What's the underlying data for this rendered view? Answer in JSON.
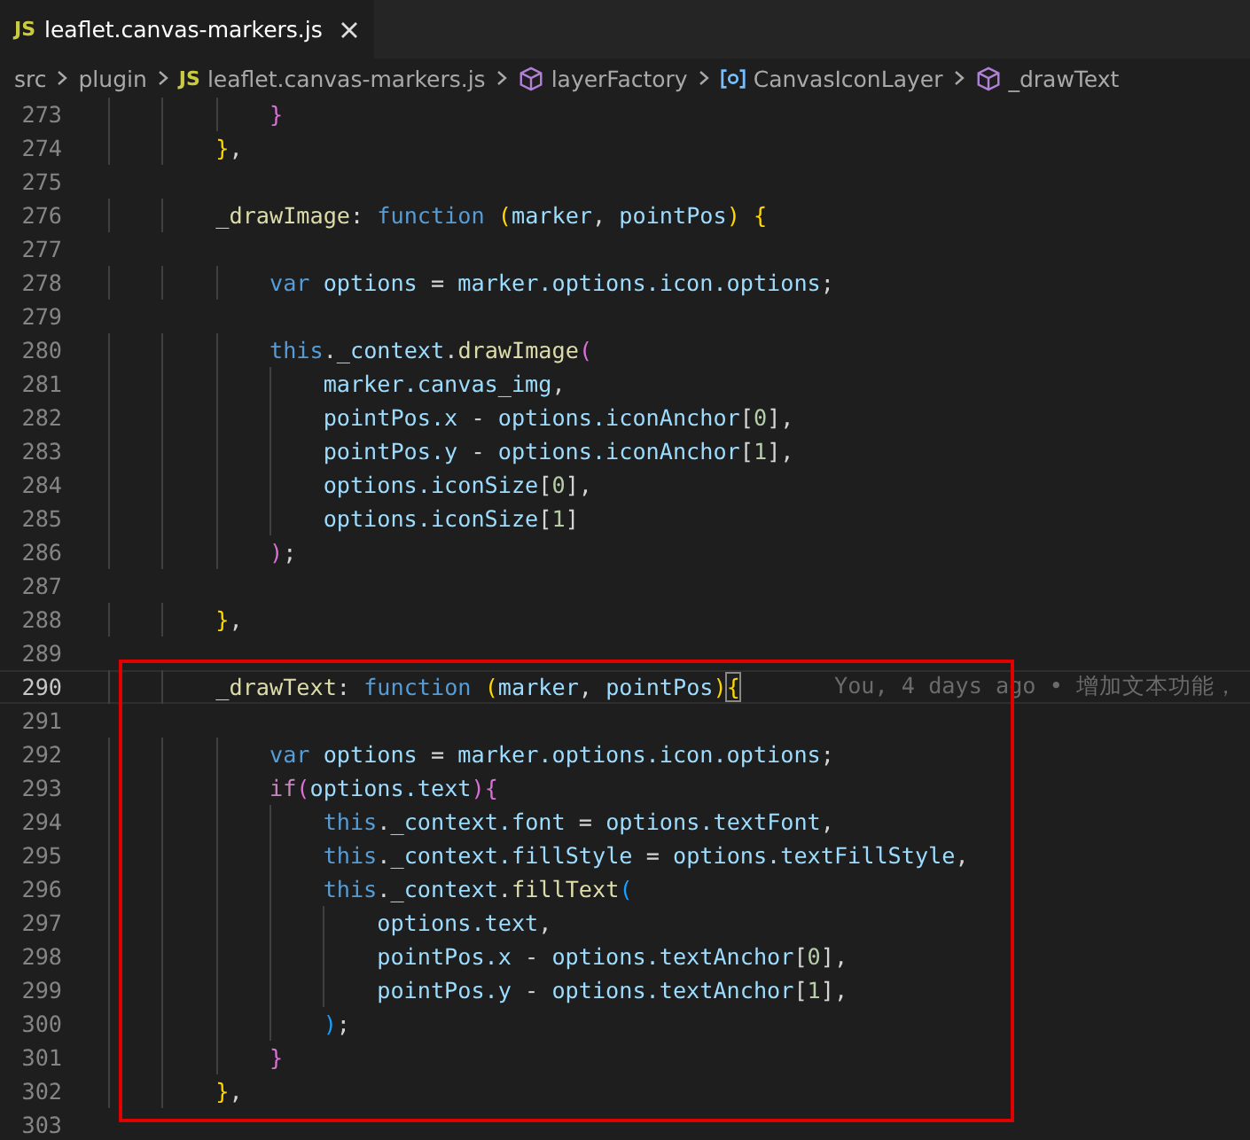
{
  "tab": {
    "icon": "JS",
    "filename": "leaflet.canvas-markers.js",
    "selected": true
  },
  "breadcrumb": [
    {
      "kind": "folder",
      "label": "src"
    },
    {
      "kind": "folder",
      "label": "plugin"
    },
    {
      "kind": "file",
      "icon": "JS",
      "label": "leaflet.canvas-markers.js"
    },
    {
      "kind": "method",
      "label": "layerFactory"
    },
    {
      "kind": "field",
      "label": "CanvasIconLayer"
    },
    {
      "kind": "method",
      "label": "_drawText"
    }
  ],
  "code_blocks": [
    {
      "highlighted": false,
      "lines": [
        {
          "number": "273",
          "current": false,
          "tokens": [
            {
              "text": "            }",
              "kind": "bracket-purple"
            }
          ]
        },
        {
          "number": "274",
          "current": false,
          "tokens": [
            {
              "text": "        }",
              "kind": "bracket-gold"
            },
            {
              "text": ",",
              "kind": "punctuation"
            }
          ]
        },
        {
          "number": "275",
          "current": false
        },
        {
          "number": "276",
          "current": false,
          "tokens": [
            {
              "text": "        _drawImage",
              "kind": "function"
            },
            {
              "text": ": ",
              "kind": "punctuation"
            },
            {
              "text": "function",
              "kind": "keyword"
            },
            {
              "text": " (",
              "kind": "bracket-gold"
            },
            {
              "text": "marker",
              "kind": "variable"
            },
            {
              "text": ", ",
              "kind": "punctuation"
            },
            {
              "text": "pointPos",
              "kind": "variable"
            },
            {
              "text": ")",
              "kind": "bracket-gold"
            },
            {
              "text": " {",
              "kind": "bracket-gold"
            }
          ]
        },
        {
          "number": "277",
          "current": false
        },
        {
          "number": "278",
          "current": false,
          "tokens": [
            {
              "text": "            var",
              "kind": "keyword"
            },
            {
              "text": " options",
              "kind": "variable"
            },
            {
              "text": " = ",
              "kind": "punctuation"
            },
            {
              "text": "marker.options.icon.options",
              "kind": "variable"
            },
            {
              "text": ";",
              "kind": "punctuation"
            }
          ]
        },
        {
          "number": "279",
          "current": false
        },
        {
          "number": "280",
          "current": false,
          "tokens": [
            {
              "text": "            this",
              "kind": "keyword"
            },
            {
              "text": ".",
              "kind": "punctuation"
            },
            {
              "text": "_context",
              "kind": "variable"
            },
            {
              "text": ".",
              "kind": "punctuation"
            },
            {
              "text": "drawImage",
              "kind": "function"
            },
            {
              "text": "(",
              "kind": "bracket-purple"
            }
          ]
        },
        {
          "number": "281",
          "current": false,
          "tokens": [
            {
              "text": "                marker.canvas_img",
              "kind": "variable"
            },
            {
              "text": ",",
              "kind": "punctuation"
            }
          ]
        },
        {
          "number": "282",
          "current": false,
          "tokens": [
            {
              "text": "                pointPos.x",
              "kind": "variable"
            },
            {
              "text": " - ",
              "kind": "punctuation"
            },
            {
              "text": "options.iconAnchor",
              "kind": "variable"
            },
            {
              "text": "[",
              "kind": "punctuation"
            },
            {
              "text": "0",
              "kind": "number"
            },
            {
              "text": "],",
              "kind": "punctuation"
            }
          ]
        },
        {
          "number": "283",
          "current": false,
          "tokens": [
            {
              "text": "                pointPos.y",
              "kind": "variable"
            },
            {
              "text": " - ",
              "kind": "punctuation"
            },
            {
              "text": "options.iconAnchor",
              "kind": "variable"
            },
            {
              "text": "[",
              "kind": "punctuation"
            },
            {
              "text": "1",
              "kind": "number"
            },
            {
              "text": "],",
              "kind": "punctuation"
            }
          ]
        },
        {
          "number": "284",
          "current": false,
          "tokens": [
            {
              "text": "                options.iconSize",
              "kind": "variable"
            },
            {
              "text": "[",
              "kind": "punctuation"
            },
            {
              "text": "0",
              "kind": "number"
            },
            {
              "text": "],",
              "kind": "punctuation"
            }
          ]
        },
        {
          "number": "285",
          "current": false,
          "tokens": [
            {
              "text": "                options.iconSize",
              "kind": "variable"
            },
            {
              "text": "[",
              "kind": "punctuation"
            },
            {
              "text": "1",
              "kind": "number"
            },
            {
              "text": "]",
              "kind": "punctuation"
            }
          ]
        },
        {
          "number": "286",
          "current": false,
          "tokens": [
            {
              "text": "            )",
              "kind": "bracket-purple"
            },
            {
              "text": ";",
              "kind": "punctuation"
            }
          ]
        },
        {
          "number": "287",
          "current": false
        },
        {
          "number": "288",
          "current": false,
          "tokens": [
            {
              "text": "        }",
              "kind": "bracket-gold"
            },
            {
              "text": ",",
              "kind": "punctuation"
            }
          ]
        },
        {
          "number": "289",
          "current": false
        }
      ]
    },
    {
      "highlighted": true,
      "lines": [
        {
          "number": "290",
          "current": true,
          "blame": "You, 4 days ago • 增加文本功能，",
          "tokens": [
            {
              "text": "        _drawText",
              "kind": "function"
            },
            {
              "text": ": ",
              "kind": "punctuation"
            },
            {
              "text": "function",
              "kind": "keyword"
            },
            {
              "text": " (",
              "kind": "bracket-gold"
            },
            {
              "text": "marker",
              "kind": "variable"
            },
            {
              "text": ", ",
              "kind": "punctuation"
            },
            {
              "text": "pointPos",
              "kind": "variable"
            },
            {
              "text": ")",
              "kind": "bracket-gold"
            },
            {
              "text": "{",
              "kind": "matched-bracket"
            }
          ]
        },
        {
          "number": "291",
          "current": false
        },
        {
          "number": "292",
          "current": false,
          "tokens": [
            {
              "text": "            var",
              "kind": "keyword"
            },
            {
              "text": " options",
              "kind": "variable"
            },
            {
              "text": " = ",
              "kind": "punctuation"
            },
            {
              "text": "marker.options.icon.options",
              "kind": "variable"
            },
            {
              "text": ";",
              "kind": "punctuation"
            }
          ]
        },
        {
          "number": "293",
          "current": false,
          "tokens": [
            {
              "text": "            if",
              "kind": "control"
            },
            {
              "text": "(",
              "kind": "bracket-purple"
            },
            {
              "text": "options.text",
              "kind": "variable"
            },
            {
              "text": ")",
              "kind": "bracket-purple"
            },
            {
              "text": "{",
              "kind": "bracket-purple"
            }
          ]
        },
        {
          "number": "294",
          "current": false,
          "tokens": [
            {
              "text": "                this",
              "kind": "keyword"
            },
            {
              "text": ".",
              "kind": "punctuation"
            },
            {
              "text": "_context.font",
              "kind": "variable"
            },
            {
              "text": " = ",
              "kind": "punctuation"
            },
            {
              "text": "options.textFont",
              "kind": "variable"
            },
            {
              "text": ",",
              "kind": "punctuation"
            }
          ]
        },
        {
          "number": "295",
          "current": false,
          "tokens": [
            {
              "text": "                this",
              "kind": "keyword"
            },
            {
              "text": ".",
              "kind": "punctuation"
            },
            {
              "text": "_context.fillStyle",
              "kind": "variable"
            },
            {
              "text": " = ",
              "kind": "punctuation"
            },
            {
              "text": "options.textFillStyle",
              "kind": "variable"
            },
            {
              "text": ",",
              "kind": "punctuation"
            }
          ]
        },
        {
          "number": "296",
          "current": false,
          "tokens": [
            {
              "text": "                this",
              "kind": "keyword"
            },
            {
              "text": ".",
              "kind": "punctuation"
            },
            {
              "text": "_context",
              "kind": "variable"
            },
            {
              "text": ".",
              "kind": "punctuation"
            },
            {
              "text": "fillText",
              "kind": "function"
            },
            {
              "text": "(",
              "kind": "bracket-blue"
            }
          ]
        },
        {
          "number": "297",
          "current": false,
          "tokens": [
            {
              "text": "                    options.text",
              "kind": "variable"
            },
            {
              "text": ",",
              "kind": "punctuation"
            }
          ]
        },
        {
          "number": "298",
          "current": false,
          "tokens": [
            {
              "text": "                    pointPos.x",
              "kind": "variable"
            },
            {
              "text": " - ",
              "kind": "punctuation"
            },
            {
              "text": "options.textAnchor",
              "kind": "variable"
            },
            {
              "text": "[",
              "kind": "punctuation"
            },
            {
              "text": "0",
              "kind": "number"
            },
            {
              "text": "],",
              "kind": "punctuation"
            }
          ]
        },
        {
          "number": "299",
          "current": false,
          "tokens": [
            {
              "text": "                    pointPos.y",
              "kind": "variable"
            },
            {
              "text": " - ",
              "kind": "punctuation"
            },
            {
              "text": "options.textAnchor",
              "kind": "variable"
            },
            {
              "text": "[",
              "kind": "punctuation"
            },
            {
              "text": "1",
              "kind": "number"
            },
            {
              "text": "],",
              "kind": "punctuation"
            }
          ]
        },
        {
          "number": "300",
          "current": false,
          "tokens": [
            {
              "text": "                )",
              "kind": "bracket-blue"
            },
            {
              "text": ";",
              "kind": "punctuation"
            }
          ]
        },
        {
          "number": "301",
          "current": false,
          "tokens": [
            {
              "text": "            }",
              "kind": "bracket-purple"
            }
          ]
        },
        {
          "number": "302",
          "current": false,
          "tokens": [
            {
              "text": "        }",
              "kind": "bracket-gold"
            },
            {
              "text": ",",
              "kind": "punctuation"
            }
          ]
        }
      ]
    },
    {
      "highlighted": false,
      "lines": [
        {
          "number": "303",
          "current": false
        }
      ]
    }
  ]
}
